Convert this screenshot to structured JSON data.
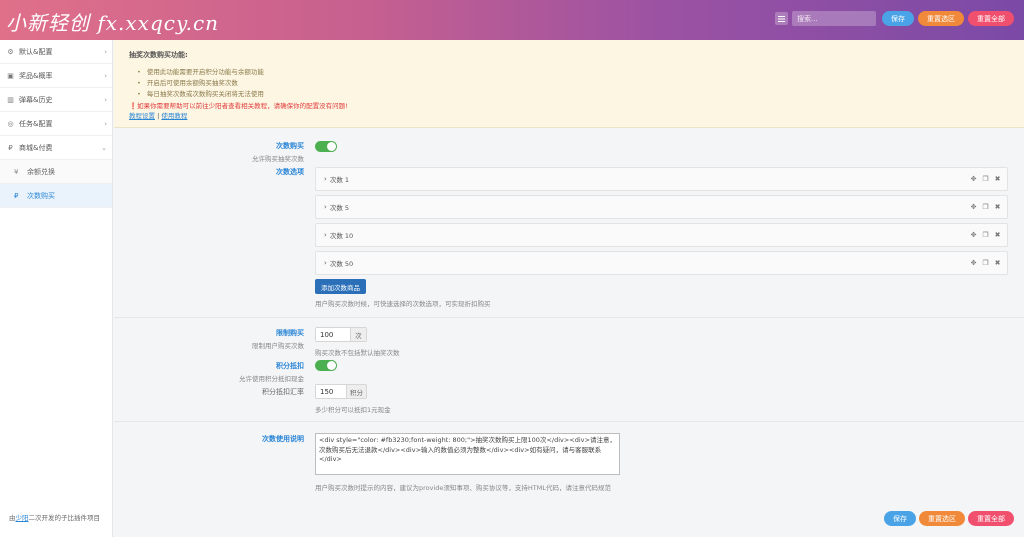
{
  "header": {
    "logo": "小新轻创 fx.xxqcy.cn",
    "search_placeholder": "搜索...",
    "save": "保存",
    "reset_current": "重置选区",
    "reset_all": "重置全部"
  },
  "sidebar": {
    "items": [
      {
        "icon": "gear-icon",
        "label": "默认&配置"
      },
      {
        "icon": "gift-icon",
        "label": "奖品&概率"
      },
      {
        "icon": "map-icon",
        "label": "弹幕&历史"
      },
      {
        "icon": "gamepad-icon",
        "label": "任务&配置"
      },
      {
        "icon": "yen-icon",
        "label": "商城&付费"
      }
    ],
    "sub_items": [
      {
        "icon": "yen-icon",
        "label": "余额兑换"
      },
      {
        "icon": "yen-icon",
        "label": "次数购买"
      }
    ],
    "footer_prefix": "由",
    "footer_link": "少阳",
    "footer_suffix": "二次开发的子比插件项目"
  },
  "notice": {
    "title": "抽奖次数购买功能:",
    "bullets": [
      "使用此功能需要开启积分功能与余额功能",
      "开启后可使用余额购买抽奖次数",
      "每日抽奖次数或次数购买关闭将无法使用"
    ],
    "warning": "❗如果你需要帮助可以前往少阳者查看相关教程，请确保你的配置没有问题!",
    "link1": "教程设置",
    "link_sep": "|",
    "link2": "使用教程"
  },
  "form": {
    "buy_times": {
      "label": "次数购买",
      "desc": "允许购买抽奖次数",
      "enabled": true
    },
    "times_options": {
      "label": "次数选项",
      "items": [
        "次数 1",
        "次数 5",
        "次数 10",
        "次数 50"
      ],
      "add_button": "添加次数商品",
      "help": "用户购买次数时候，可快速选择的次数选项，可实现折扣购买"
    },
    "limit_buy": {
      "label": "限制购买",
      "desc": "限制用户购买次数",
      "value": "100",
      "unit": "次",
      "help": "购买次数不包括默认抽奖次数"
    },
    "points_deduct": {
      "label": "积分抵扣",
      "desc": "允许使用积分抵扣现金",
      "enabled": true
    },
    "points_rate": {
      "label": "积分抵扣汇率",
      "value": "150",
      "unit": "积分",
      "help": "多少积分可以抵扣1元现金"
    },
    "usage_desc": {
      "label": "次数使用说明",
      "content": "<div style=\"color: #fb3230;font-weight: 800;\">抽奖次数购买上限100次</div><div>请注意，次数购买后无法退款</div><div>输入的数值必须为整数</div><div>如有疑问，请与客服联系</div>",
      "help": "用户购买次数时提示的内容，建议为provide须知事项、购买协议等，支持HTML代码，请注意代码规范"
    }
  },
  "footer": {
    "save": "保存",
    "reset_current": "重置选区",
    "reset_all": "重置全部"
  },
  "colors": {
    "accent": "#2a86d6",
    "toggle_on": "#4caf50",
    "warning": "#e03c3c"
  }
}
